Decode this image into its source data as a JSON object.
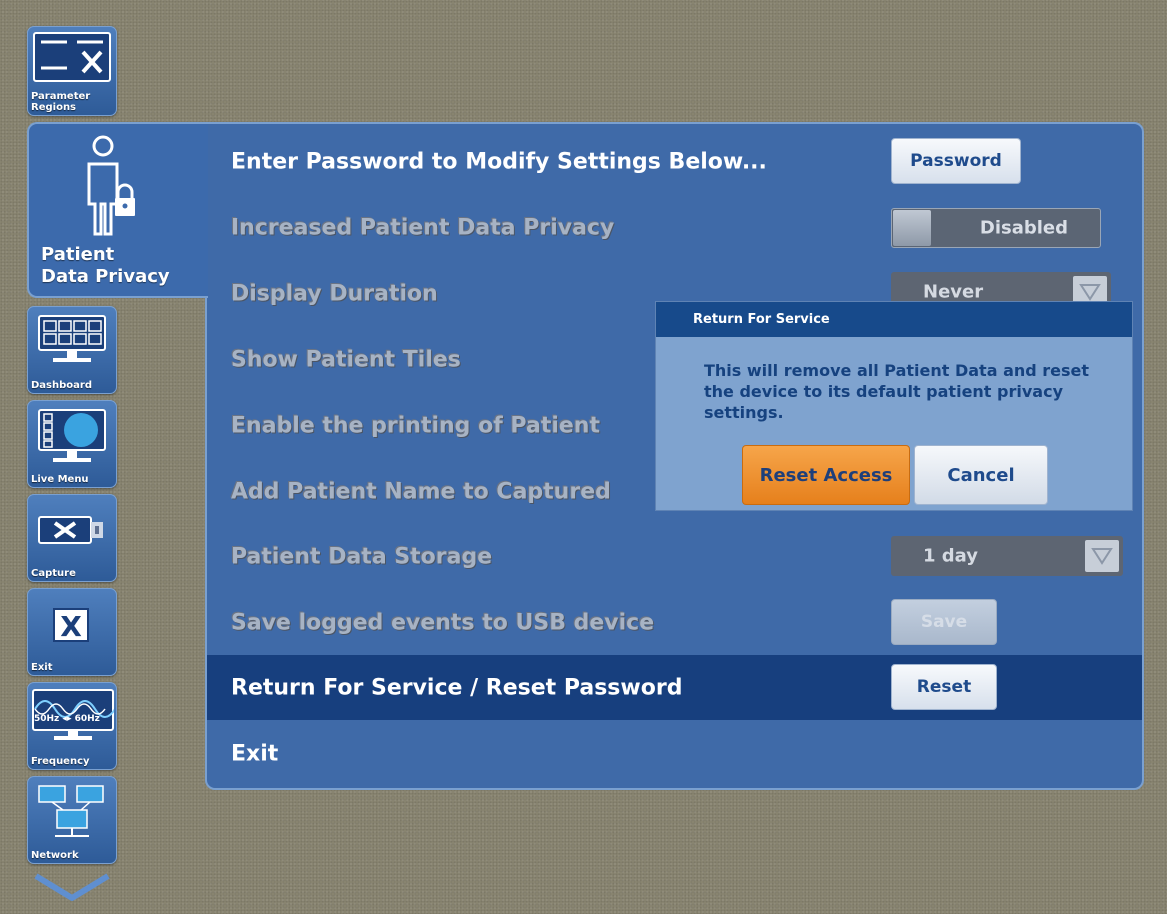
{
  "sidebar": {
    "parameter_regions": "Parameter\nRegions",
    "patient_data_privacy": "Patient\nData Privacy",
    "dashboard": "Dashboard",
    "live_menu": "Live Menu",
    "capture": "Capture",
    "exit": "Exit",
    "frequency": "Frequency",
    "frequency_icon_text": "50Hz ◂▸ 60Hz",
    "network": "Network"
  },
  "settings": {
    "password_row": {
      "label": "Enter Password to Modify Settings Below...",
      "button": "Password"
    },
    "privacy_row": {
      "label": "Increased Patient Data Privacy",
      "toggle": "Disabled"
    },
    "duration_row": {
      "label": "Display Duration",
      "value": "Never"
    },
    "tiles_row": {
      "label": "Show Patient Tiles"
    },
    "printing_row": {
      "label": "Enable the printing of Patient"
    },
    "capture_name_row": {
      "label": "Add Patient Name to Captured"
    },
    "storage_row": {
      "label": "Patient Data Storage",
      "value": "1 day"
    },
    "usb_row": {
      "label": "Save logged events to USB device",
      "button": "Save"
    },
    "reset_row": {
      "label": "Return For Service / Reset Password",
      "button": "Reset"
    },
    "exit_row": {
      "label": "Exit"
    }
  },
  "dialog": {
    "title": "Return For Service",
    "message": "This will remove all Patient Data and reset the device to its default patient privacy settings.",
    "confirm": "Reset Access",
    "cancel": "Cancel"
  }
}
